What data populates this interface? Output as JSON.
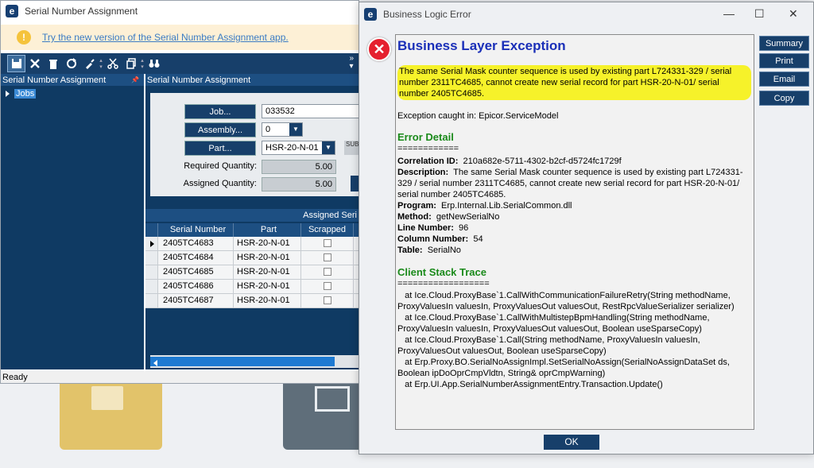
{
  "main_window": {
    "title": "Serial Number Assignment",
    "banner_link": "Try the new version of the Serial Number Assignment app.",
    "left_panel_title": "Serial Number Assignment",
    "pin_glyph": "📌",
    "tree_item": "Jobs",
    "right_panel_title": "Serial Number Assignment",
    "fields": {
      "job_label": "Job...",
      "job_value": "033532",
      "assembly_label": "Assembly...",
      "assembly_value": "0",
      "part_label": "Part...",
      "part_value": "HSR-20-N-01",
      "sub_tag": "SUB",
      "required_qty_label": "Required Quantity:",
      "required_qty_value": "5.00",
      "assigned_qty_label": "Assigned Quantity:",
      "assigned_qty_value": "5.00"
    },
    "grid": {
      "title": "Assigned Seri",
      "columns": [
        "Serial Number",
        "Part",
        "Scrapped"
      ],
      "rows": [
        {
          "serial": "2405TC4683",
          "part": "HSR-20-N-01"
        },
        {
          "serial": "2405TC4684",
          "part": "HSR-20-N-01"
        },
        {
          "serial": "2405TC4685",
          "part": "HSR-20-N-01"
        },
        {
          "serial": "2405TC4686",
          "part": "HSR-20-N-01"
        },
        {
          "serial": "2405TC4687",
          "part": "HSR-20-N-01"
        }
      ]
    },
    "status": "Ready"
  },
  "error_dialog": {
    "title": "Business Logic Error",
    "heading": "Business Layer Exception",
    "message": "The same Serial Mask counter sequence is used by existing part L724331-329 / serial number 2311TC4685, cannot create new serial record for part HSR-20-N-01/ serial number 2405TC4685.",
    "exception_caught": "Exception caught in: Epicor.ServiceModel",
    "error_detail_heading": "Error Detail",
    "error_detail_rule": "============",
    "correlation_label": "Correlation ID:",
    "correlation_value": "210a682e-5711-4302-b2cf-d5724fc1729f",
    "description_label": "Description:",
    "description_value": "The same Serial Mask counter sequence is used by existing part L724331-329 / serial number 2311TC4685, cannot create new serial record for part HSR-20-N-01/ serial number 2405TC4685.",
    "program_label": "Program:",
    "program_value": "Erp.Internal.Lib.SerialCommon.dll",
    "method_label": "Method:",
    "method_value": "getNewSerialNo",
    "line_label": "Line Number:",
    "line_value": "96",
    "column_label": "Column Number:",
    "column_value": "54",
    "table_label": "Table:",
    "table_value": "SerialNo",
    "stack_heading": "Client Stack Trace",
    "stack_rule": "==================",
    "stack_trace": "   at Ice.Cloud.ProxyBase`1.CallWithCommunicationFailureRetry(String methodName, ProxyValuesIn valuesIn, ProxyValuesOut valuesOut, RestRpcValueSerializer serializer)\n   at Ice.Cloud.ProxyBase`1.CallWithMultistepBpmHandling(String methodName, ProxyValuesIn valuesIn, ProxyValuesOut valuesOut, Boolean useSparseCopy)\n   at Ice.Cloud.ProxyBase`1.Call(String methodName, ProxyValuesIn valuesIn, ProxyValuesOut valuesOut, Boolean useSparseCopy)\n   at Erp.Proxy.BO.SerialNoAssignImpl.SetSerialNoAssign(SerialNoAssignDataSet ds, Boolean ipDoOprCmpVldtn, String& oprCmpWarning)\n   at Erp.UI.App.SerialNumberAssignmentEntry.Transaction.Update()",
    "buttons": {
      "summary": "Summary",
      "print": "Print",
      "email": "Email",
      "copy": "Copy",
      "ok": "OK"
    }
  },
  "icons": {
    "app_logo": "e",
    "warning": "!",
    "error": "✕",
    "minimize": "—",
    "maximize": "☐",
    "close": "✕"
  },
  "colors": {
    "navy": "#173f6a",
    "highlight_yellow": "#f6f22a",
    "heading_blue": "#1a2fb8",
    "section_green": "#1a8a1a",
    "error_red": "#e5202e"
  }
}
